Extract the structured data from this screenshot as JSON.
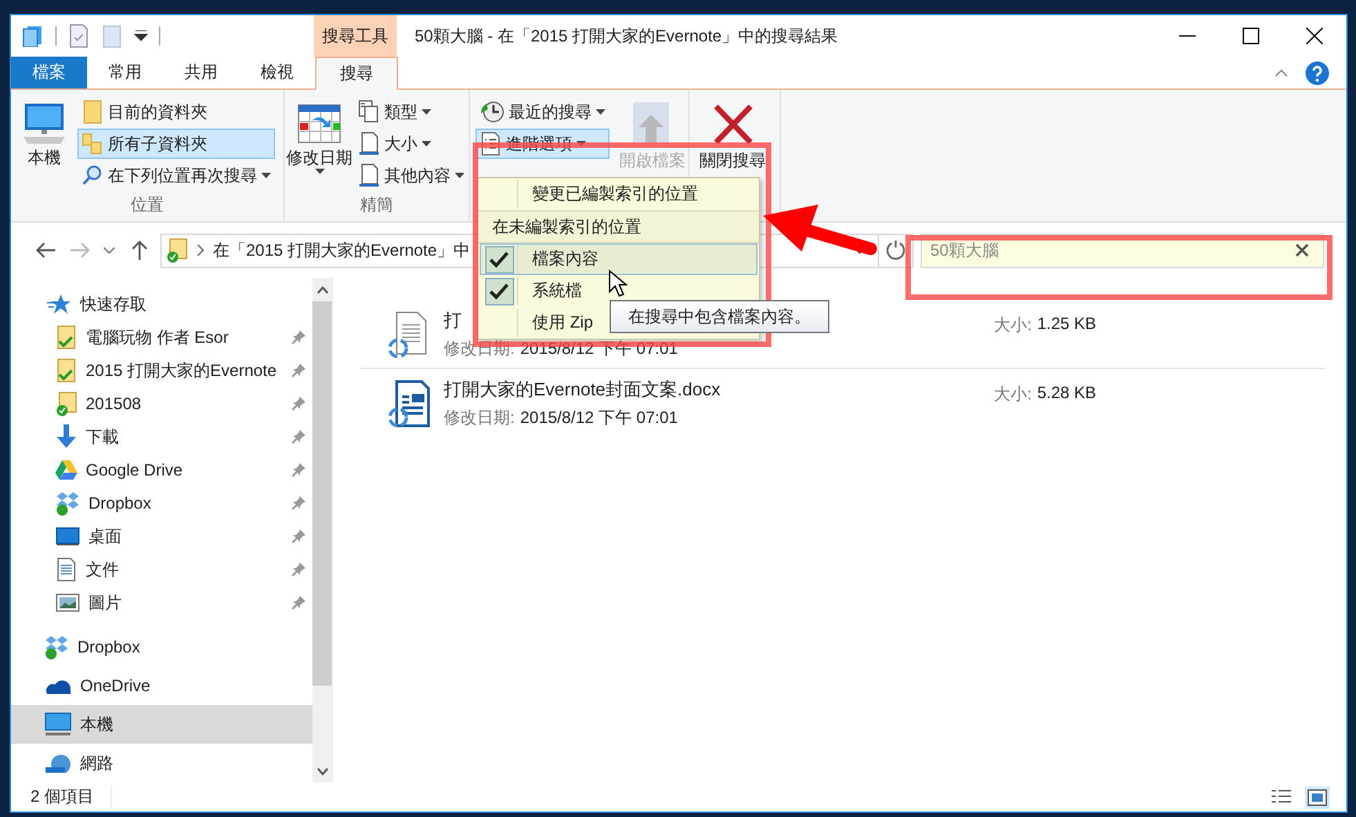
{
  "window": {
    "title": "50顆大腦 - 在「2015 打開大家的Evernote」中的搜尋結果",
    "context_tab": "搜尋工具"
  },
  "ribbon_tabs": [
    {
      "label": "檔案",
      "kind": "file",
      "selected": false
    },
    {
      "label": "常用",
      "kind": "tab",
      "selected": false
    },
    {
      "label": "共用",
      "kind": "tab",
      "selected": false
    },
    {
      "label": "檢視",
      "kind": "tab",
      "selected": false
    },
    {
      "label": "搜尋",
      "kind": "tab",
      "selected": true
    }
  ],
  "ribbon_groups": [
    {
      "label": "位置",
      "items": [
        {
          "kind": "large",
          "label": "本機",
          "dropdown": false,
          "selected": false,
          "disabled": false
        },
        {
          "kind": "small",
          "label": "目前的資料夾",
          "dropdown": false,
          "selected": false,
          "disabled": false
        },
        {
          "kind": "small",
          "label": "所有子資料夾",
          "dropdown": false,
          "selected": true,
          "disabled": false
        },
        {
          "kind": "small",
          "label": "在下列位置再次搜尋",
          "dropdown": true,
          "selected": false,
          "disabled": false
        }
      ]
    },
    {
      "label": "精簡",
      "items": [
        {
          "kind": "large",
          "label": "修改日期",
          "dropdown": true,
          "selected": false,
          "disabled": false
        },
        {
          "kind": "small",
          "label": "類型",
          "dropdown": true,
          "selected": false,
          "disabled": false
        },
        {
          "kind": "small",
          "label": "大小",
          "dropdown": true,
          "selected": false,
          "disabled": false
        },
        {
          "kind": "small",
          "label": "其他內容",
          "dropdown": true,
          "selected": false,
          "disabled": false
        }
      ]
    },
    {
      "items": [
        {
          "kind": "small",
          "label": "最近的搜尋",
          "dropdown": true,
          "selected": false,
          "disabled": false
        },
        {
          "kind": "small",
          "label": "進階選項",
          "dropdown": true,
          "selected": true,
          "disabled": false
        },
        {
          "kind": "large",
          "label": "開啟檔案",
          "dropdown": false,
          "selected": false,
          "disabled": true
        }
      ]
    },
    {
      "items": [
        {
          "kind": "large",
          "label": "關閉搜尋",
          "dropdown": false,
          "selected": false,
          "disabled": false
        }
      ]
    }
  ],
  "address_bar": {
    "path": "在「2015 打開大家的Evernote」中"
  },
  "search_box": {
    "value": "50顆大腦"
  },
  "navigation": [
    {
      "label": "快速存取",
      "selected": false,
      "children": [
        {
          "label": "電腦玩物 作者 Esor",
          "pinned": true,
          "selected": false
        },
        {
          "label": "2015 打開大家的Evernote",
          "pinned": true,
          "selected": false
        },
        {
          "label": "201508",
          "pinned": true,
          "selected": false
        },
        {
          "label": "下載",
          "pinned": true,
          "selected": false
        },
        {
          "label": "Google Drive",
          "pinned": true,
          "selected": false
        },
        {
          "label": "Dropbox",
          "pinned": true,
          "selected": false
        },
        {
          "label": "桌面",
          "pinned": true,
          "selected": false
        },
        {
          "label": "文件",
          "pinned": true,
          "selected": false
        },
        {
          "label": "圖片",
          "pinned": true,
          "selected": false
        }
      ]
    },
    {
      "label": "Dropbox",
      "selected": false
    },
    {
      "label": "OneDrive",
      "selected": false
    },
    {
      "label": "本機",
      "selected": true
    },
    {
      "label": "網路",
      "selected": false
    }
  ],
  "files": [
    {
      "name": "打",
      "date_label": "修改日期:",
      "date": "2015/8/12 下午 07:01",
      "size_label": "大小:",
      "size": "1.25 KB"
    },
    {
      "name": "打開大家的Evernote封面文案.docx",
      "date_label": "修改日期:",
      "date": "2015/8/12 下午 07:01",
      "size_label": "大小:",
      "size": "5.28 KB"
    }
  ],
  "status_bar": {
    "item_count": "2 個項目"
  },
  "advanced_menu": {
    "items": [
      {
        "kind": "command",
        "label": "變更已編製索引的位置",
        "checked": false,
        "hovered": false
      },
      {
        "kind": "header",
        "label": "在未編製索引的位置"
      },
      {
        "kind": "toggle",
        "label": "檔案內容",
        "checked": true,
        "hovered": true
      },
      {
        "kind": "toggle",
        "label": "系統檔",
        "checked": true,
        "hovered": false
      },
      {
        "kind": "toggle",
        "label": "使用 Zip",
        "checked": false,
        "hovered": false
      }
    ]
  },
  "tooltip": "在搜尋中包含檔案內容。",
  "annotations": [
    {
      "kind": "frame"
    },
    {
      "kind": "frame"
    },
    {
      "kind": "arrow"
    }
  ]
}
